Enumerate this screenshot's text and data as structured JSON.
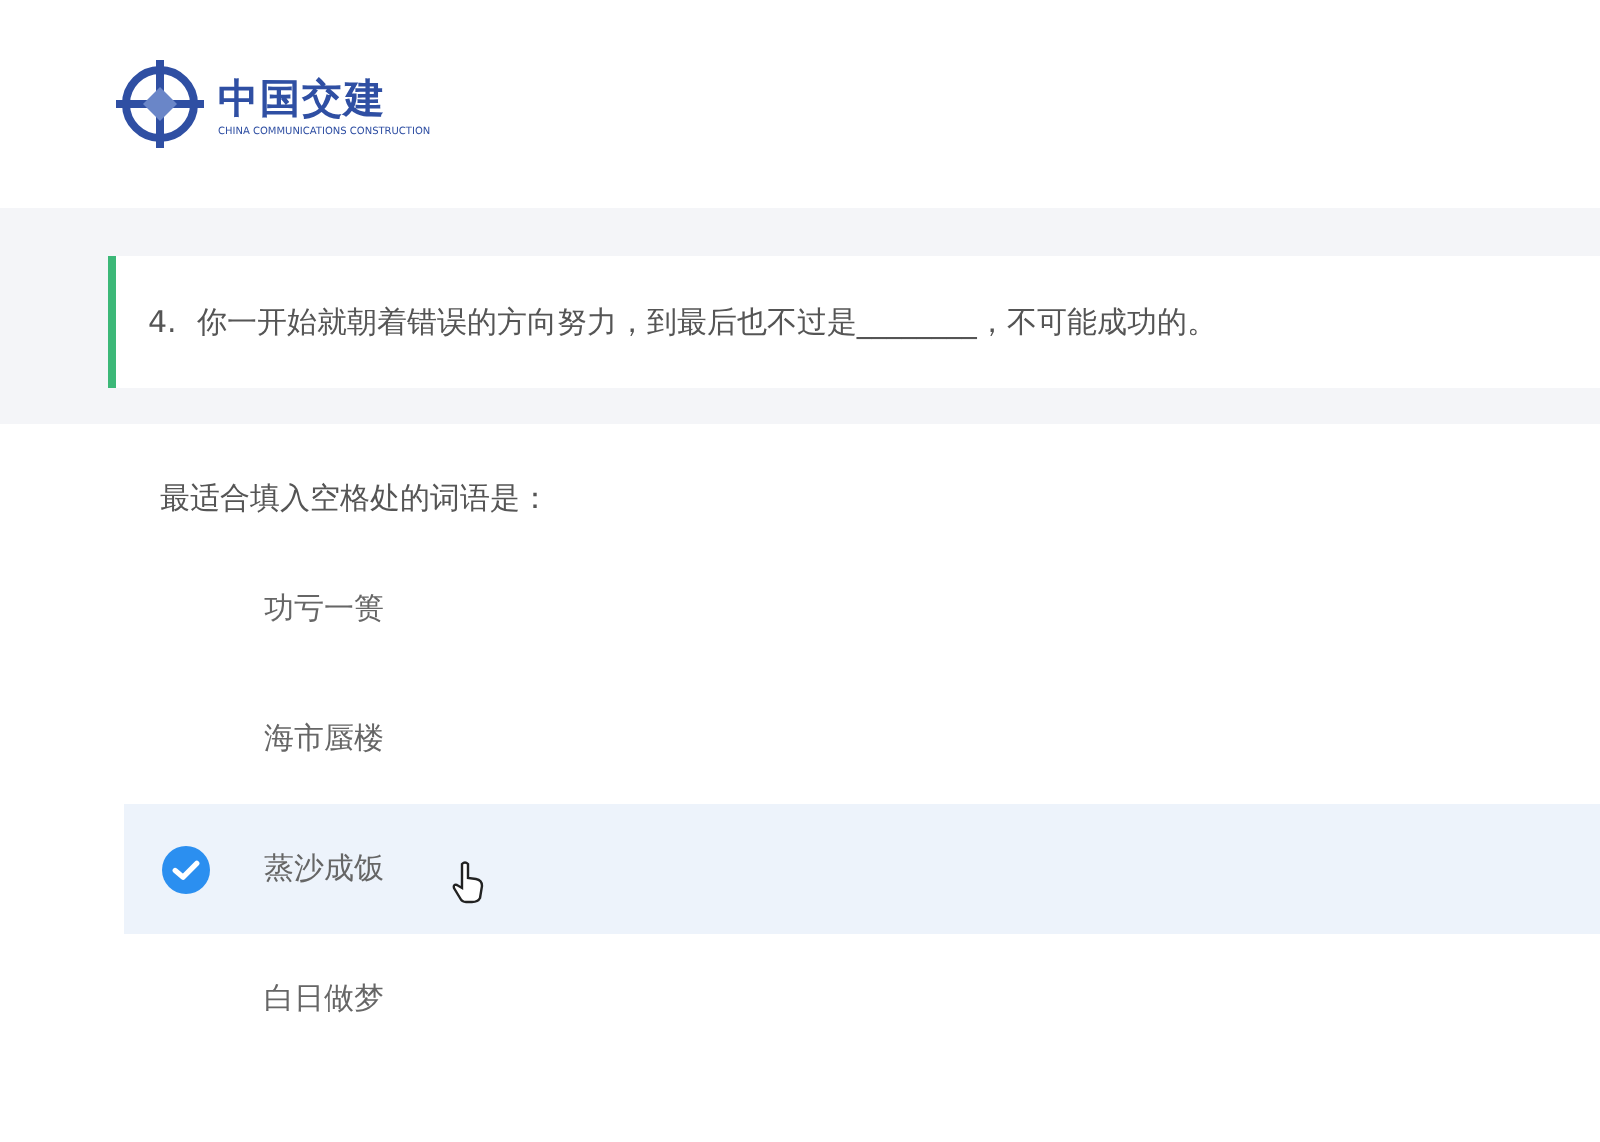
{
  "logo": {
    "name": "中国交建",
    "subtitle": "CHINA COMMUNICATIONS CONSTRUCTION"
  },
  "question": {
    "number": "4.",
    "text": "你一开始就朝着错误的方向努力，到最后也不过是________，不可能成功的。"
  },
  "prompt": "最适合填入空格处的词语是：",
  "options": [
    {
      "label": "功亏一篑",
      "selected": false
    },
    {
      "label": "海市蜃楼",
      "selected": false
    },
    {
      "label": "蒸沙成饭",
      "selected": true
    },
    {
      "label": "白日做梦",
      "selected": false
    }
  ]
}
